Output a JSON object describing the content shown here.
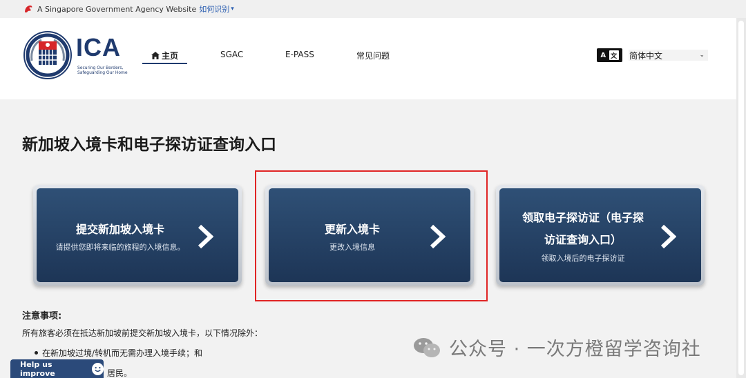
{
  "gov_bar": {
    "text": "A Singapore Government Agency Website",
    "link": "如何识别"
  },
  "header": {
    "logo_text": "ICA",
    "tagline_1": "Securing Our Borders,",
    "tagline_2": "Safeguarding Our Home",
    "nav": [
      {
        "label": "主页",
        "active": true
      },
      {
        "label": "SGAC",
        "active": false
      },
      {
        "label": "E-PASS",
        "active": false
      },
      {
        "label": "常见问题",
        "active": false
      }
    ],
    "language": {
      "selected": "简体中文"
    }
  },
  "main": {
    "title": "新加坡入境卡和电子探访证查询入口",
    "cards": [
      {
        "title": "提交新加坡入境卡",
        "subtitle": "请提供您即将来临的旅程的入境信息。"
      },
      {
        "title": "更新入境卡",
        "subtitle": "更改入境信息"
      },
      {
        "title_line1": "领取电子探访证（电子探",
        "title_line2": "访证查询入口）",
        "subtitle": "领取入境后的电子探访证"
      }
    ],
    "notes": {
      "title": "注意事项:",
      "text": "所有旅客必须在抵达新加坡前提交新加坡入境卡，以下情况除外：",
      "bullets": [
        "在新加坡过境/转机而无需办理入境手续；和",
        "居民。"
      ]
    }
  },
  "help_button": {
    "label": "Help us improve"
  },
  "watermark": {
    "text": "公众号 · 一次方橙留学咨询社"
  },
  "colors": {
    "brand_navy": "#1f3a6e",
    "card_blue": "#2a4a70",
    "highlight_red": "#e02424"
  }
}
